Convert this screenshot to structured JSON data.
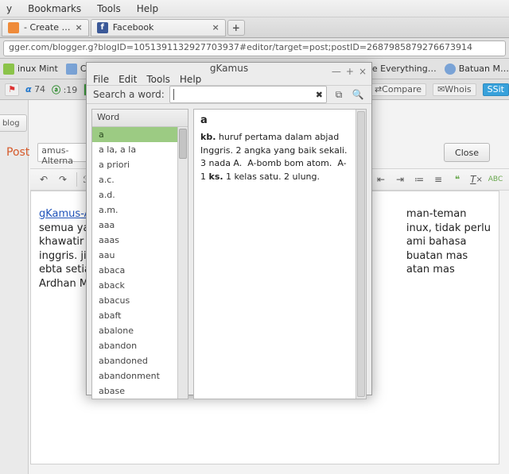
{
  "browser": {
    "menu": [
      "y",
      "Bookmarks",
      "Tools",
      "Help"
    ],
    "tabs": [
      {
        "label": "- Create …",
        "icon": "#ef8b3a"
      },
      {
        "label": "Facebook",
        "icon": "fb"
      }
    ],
    "url": "gger.com/blogger.g?blogID=1051391132927703937#editor/target=post;postID=2687985879276673914",
    "bookmarks": [
      {
        "label": "inux Mint",
        "icon": "#8bc34a"
      },
      {
        "label": "Commu…",
        "icon": "#7aa3d6"
      },
      {
        "label": "hare Everything…",
        "icon": "#999"
      },
      {
        "label": "Batuan M…",
        "icon": "#7aa3d6"
      }
    ],
    "toolbar2_labels": {
      "alpha_value": "74",
      "a_value": ":19",
      "compare": "Compare",
      "whois": "Whois",
      "sit": "Sit"
    }
  },
  "blogger": {
    "new_blog": "ew blog",
    "post_label": "Post",
    "title_value": "amus-Alterna",
    "close_label": "Close",
    "format_btns": {
      "italic": "ℱ",
      "strike": "T",
      "list": "≡",
      "num": "⅟",
      "ol": "≔",
      "quote": "❝",
      "clear": "✂",
      "abc": "ᴬᴮᶜ"
    },
    "body_link": "gKamus-A",
    "body_lines": [
      "man-teman",
      "semua ya",
      "inux, tidak perlu",
      "khawatir",
      "ami bahasa",
      "inggris. ji",
      "buatan mas",
      "ebta setia",
      "atan mas",
      "Ardhan M"
    ]
  },
  "gkamus": {
    "title": "gKamus",
    "menu": [
      "File",
      "Edit",
      "Tools",
      "Help"
    ],
    "search_label": "Search a word:",
    "wordlist_head": "Word",
    "words": [
      "a",
      "a la, a la",
      "a priori",
      "a.c.",
      "a.d.",
      "a.m.",
      "aaa",
      "aaas",
      "aau",
      "abaca",
      "aback",
      "abacus",
      "abaft",
      "abalone",
      "abandon",
      "abandoned",
      "abandonment",
      "abase"
    ],
    "selected_index": 0,
    "definition_head": "a",
    "definition_html": "<span class='bold'>kb.</span> huruf pertama dalam abjad Inggris. 2 angka yang baik sekali. 3 nada A.&nbsp;&nbsp;A-bomb bom atom.&nbsp;&nbsp;A-1 <span class='bold'>ks.</span> 1 kelas satu. 2 ulung."
  }
}
